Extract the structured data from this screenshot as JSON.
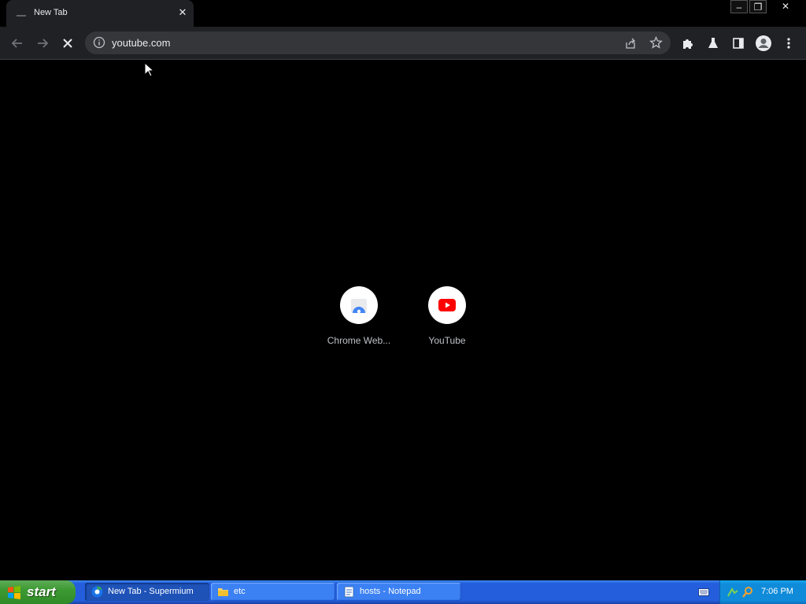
{
  "tab": {
    "title": "New Tab",
    "close_label": "✕"
  },
  "window_controls": {
    "minimize": "–",
    "restore": "❐",
    "close": "✕"
  },
  "omnibox": {
    "url": "youtube.com"
  },
  "shortcuts": [
    {
      "label": "Chrome Web..."
    },
    {
      "label": "YouTube"
    }
  ],
  "taskbar": {
    "start_label": "start",
    "tasks": [
      {
        "label": "New Tab - Supermium"
      },
      {
        "label": "etc"
      },
      {
        "label": "hosts - Notepad"
      }
    ],
    "clock": "7:06 PM"
  },
  "colors": {
    "accent_blue": "#245edc",
    "youtube_red": "#ff0000",
    "start_green": "#3c9a33"
  }
}
